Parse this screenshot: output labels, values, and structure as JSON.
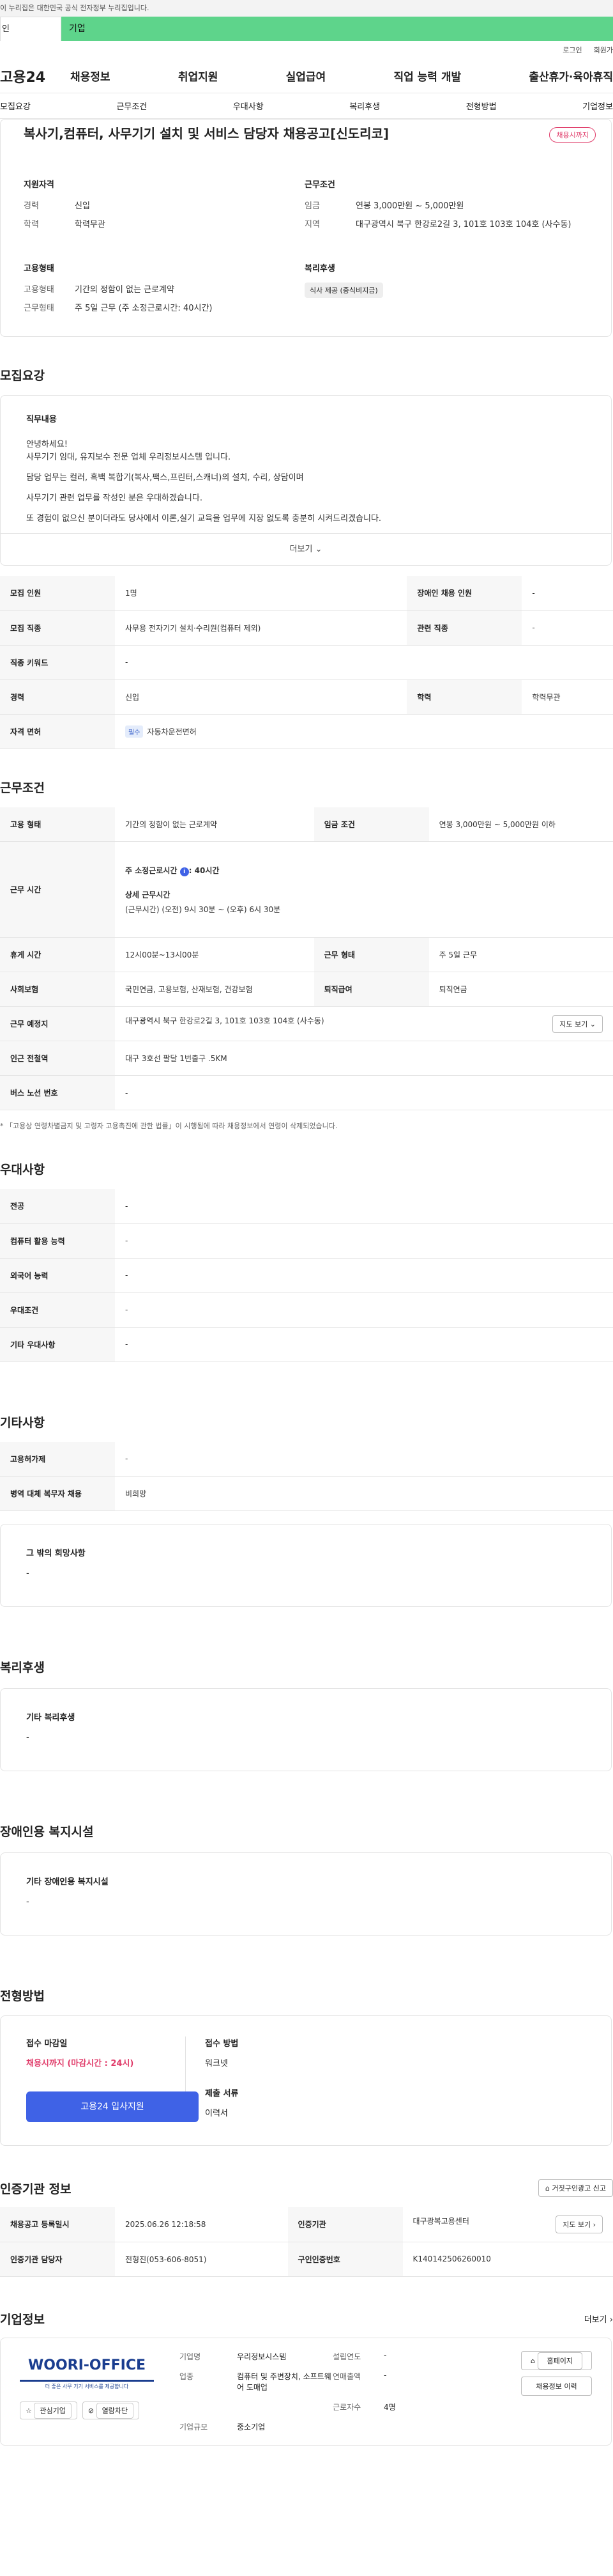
{
  "gov_notice": "이 누리집은 대한민국 공식 전자정부 누리집입니다.",
  "tabs": [
    "인",
    "기업"
  ],
  "util": {
    "login": "로그인",
    "signup": "회원가"
  },
  "site_logo": "고용24",
  "gnb": [
    "채용정보",
    "취업지원",
    "실업급여",
    "직업 능력 개발",
    "출산휴가·육아휴직"
  ],
  "subnav": [
    "모집요강",
    "근무조건",
    "우대사항",
    "복리후생",
    "전형방법",
    "기업정보"
  ],
  "job": {
    "title": "복사기,컴퓨터, 사무기기 설치 및 서비스 담당자 채용공고[신도리코]",
    "status": "채용시까지",
    "qual_title": "지원자격",
    "qual": [
      {
        "k": "경력",
        "v": "신입"
      },
      {
        "k": "학력",
        "v": "학력무관"
      }
    ],
    "cond_title": "근무조건",
    "cond": [
      {
        "k": "임금",
        "v": "연봉 3,000만원 ~ 5,000만원"
      },
      {
        "k": "지역",
        "v": "대구광역시 북구 한강로2길 3, 101호 103호 104호 (사수동)"
      }
    ],
    "emp_title": "고용형태",
    "emp": [
      {
        "k": "고용형태",
        "v": "기간의 정함이 없는 근로계약"
      },
      {
        "k": "근무형태",
        "v": "주 5일 근무 (주 소정근로시간: 40시간)"
      }
    ],
    "welfare_title": "복리후생",
    "welfare_chip": "식사 제공 (중식비지급)"
  },
  "recruit": {
    "section": "모집요강",
    "duty_title": "직무내용",
    "duty_lines": [
      "안녕하세요!",
      "사무기기 임대, 유지보수 전문 업체 우리정보시스템 입니다.",
      "담당 업무는 컬러, 흑백 복합기(복사,팩스,프린터,스캐너)의 설치, 수리, 상담이며",
      "사무기기 관련 업무를 작성인 분은 우대하겠습니다.",
      "또 경험이 없으신 분이더라도 당사에서 이론,실기 교육을 업무에 지장 없도록 충분히 시켜드리겠습니다."
    ],
    "more": "더보기",
    "rows": [
      {
        "k": "모집 인원",
        "v": "1명",
        "k2": "장애인 채용 인원",
        "v2": "-"
      },
      {
        "k": "모집 직종",
        "v": "사무용 전자기기 설치·수리원(컴퓨터 제외)",
        "k2": "관련 직종",
        "v2": "-"
      },
      {
        "k": "직종 키워드",
        "v": "-"
      },
      {
        "k": "경력",
        "v": "신입",
        "k2": "학력",
        "v2": "학력무관"
      },
      {
        "k": "자격 면허",
        "v": "자동차운전면허",
        "tag": "필수"
      }
    ]
  },
  "work": {
    "section": "근무조건",
    "type_k": "고용 형태",
    "type_v": "기간의 정함이 없는 근로계약",
    "wage_k": "임금 조건",
    "wage_v": "연봉 3,000만원 ~ 5,000만원 이하",
    "time_k": "근무 시간",
    "time_main": "주 소정근로시간",
    "time_hours": ": 40시간",
    "time_detail_title": "상세 근무시간",
    "time_detail": "(근무시간) (오전) 9시 30분 ~ (오후) 6시 30분",
    "rest_k": "휴게 시간",
    "rest_v": "12시00분~13시00분",
    "form_k": "근무 형태",
    "form_v": "주 5일 근무",
    "ins_k": "사회보험",
    "ins_v": "국민연금, 고용보험, 산재보험, 건강보험",
    "ret_k": "퇴직급여",
    "ret_v": "퇴직연금",
    "place_k": "근무 예정지",
    "place_v": "대구광역시 북구 한강로2길 3, 101호 103호 104호 (사수동)",
    "map_btn": "지도 보기",
    "subway_k": "인근 전철역",
    "subway_v": "대구 3호선 팔달 1번출구 .5KM",
    "bus_k": "버스 노선 번호",
    "bus_v": "-",
    "note": "* 「고용상 연령차별금지 및 고령자 고용촉진에 관한 법률」이 시행됨에 따라 채용정보에서 연령이 삭제되었습니다."
  },
  "pref": {
    "section": "우대사항",
    "rows": [
      {
        "k": "전공",
        "v": "-"
      },
      {
        "k": "컴퓨터 활용 능력",
        "v": "-"
      },
      {
        "k": "외국어 능력",
        "v": "-"
      },
      {
        "k": "우대조건",
        "v": "-"
      },
      {
        "k": "기타 우대사항",
        "v": "-"
      }
    ]
  },
  "etc": {
    "section": "기타사항",
    "rows": [
      {
        "k": "고용허가제",
        "v": "-"
      },
      {
        "k": "병역 대체 복무자 채용",
        "v": "비희망"
      }
    ],
    "hope_title": "그 밖의 희망사항",
    "hope_v": "-"
  },
  "benefit": {
    "section": "복리후생",
    "title": "기타 복리후생",
    "v": "-"
  },
  "disabled": {
    "section": "장애인용 복지시설",
    "title": "기타 장애인용 복지시설",
    "v": "-"
  },
  "apply": {
    "section": "전형방법",
    "deadline_title": "접수 마감일",
    "deadline_v": "채용시까지 (마감시간 : 24시)",
    "method_title": "접수 방법",
    "method_v": "워크넷",
    "docs_title": "제출 서류",
    "docs_v": "이력서",
    "btn": "고용24 입사지원"
  },
  "cert": {
    "section": "인증기관 정보",
    "report_btn": "거짓구인광고 신고",
    "rows": [
      {
        "k": "채용공고 등록일시",
        "v": "2025.06.26 12:18:58",
        "k2": "인증기관",
        "v2": "대구광복고용센터"
      },
      {
        "k": "인증기관 담당자",
        "v": "전형진(053-606-8051)",
        "k2": "구인인증번호",
        "v2": "K140142506260010"
      }
    ],
    "map_btn": "지도 보기"
  },
  "company": {
    "section": "기업정보",
    "more": "더보기",
    "brand": "WOORI-OFFICE",
    "brand_sub": "더 좋은 사무 기기 서비스를 제공합니다",
    "btn_fav": "관심기업",
    "btn_block": "열람차단",
    "rows": [
      {
        "k": "기업명",
        "v": "우리정보시스템",
        "k2": "설립연도",
        "v2": "-"
      },
      {
        "k": "업종",
        "v": "컴퓨터 및 주변장치, 소프트웨어 도매업",
        "k2": "연매출액",
        "v2": "-"
      },
      {
        "k": "",
        "v": "",
        "k2": "근로자수",
        "v2": "4명"
      },
      {
        "k": "기업규모",
        "v": "중소기업",
        "k2": "",
        "v2": ""
      }
    ],
    "btn_home": "홈페이지",
    "btn_history": "채용정보 이력"
  }
}
